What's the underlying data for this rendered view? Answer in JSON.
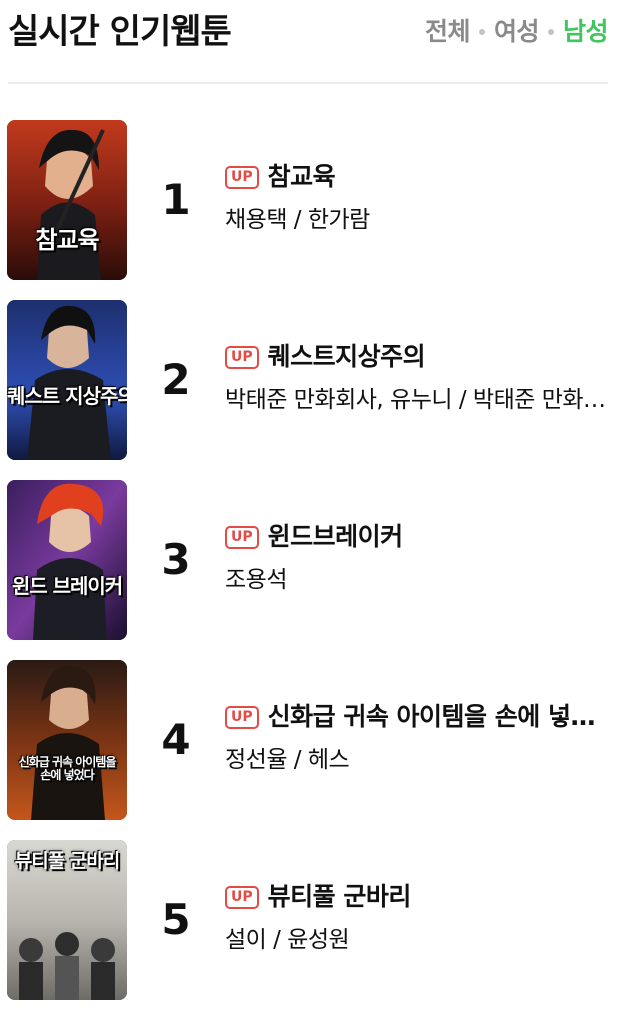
{
  "header": {
    "title": "실시간 인기웹툰",
    "tabs": [
      {
        "label": "전체",
        "active": false
      },
      {
        "label": "여성",
        "active": false
      },
      {
        "label": "남성",
        "active": true
      }
    ]
  },
  "colors": {
    "accent_active_tab": "#3fc65f",
    "inactive_tab": "#8a8a8a",
    "up_badge": "#e34b44"
  },
  "list": [
    {
      "rank": "1",
      "badge": "UP",
      "title": "참교육",
      "author": "채용택 / 한가람",
      "thumb_logo": "참교육"
    },
    {
      "rank": "2",
      "badge": "UP",
      "title": "퀘스트지상주의",
      "author": "박태준 만화회사, 유누니 / 박태준 만화회사",
      "thumb_logo": "퀘스트 지상주의"
    },
    {
      "rank": "3",
      "badge": "UP",
      "title": "윈드브레이커",
      "author": "조용석",
      "thumb_logo": "윈드 브레이커"
    },
    {
      "rank": "4",
      "badge": "UP",
      "title": "신화급 귀속 아이템을 손에 넣었다",
      "author": "정선율 / 헤스",
      "thumb_logo": "신화급 귀속 아이템을 손에 넣었다"
    },
    {
      "rank": "5",
      "badge": "UP",
      "title": "뷰티풀 군바리",
      "author": "설이 / 윤성원",
      "thumb_logo": "뷰티풀 군바리"
    }
  ]
}
